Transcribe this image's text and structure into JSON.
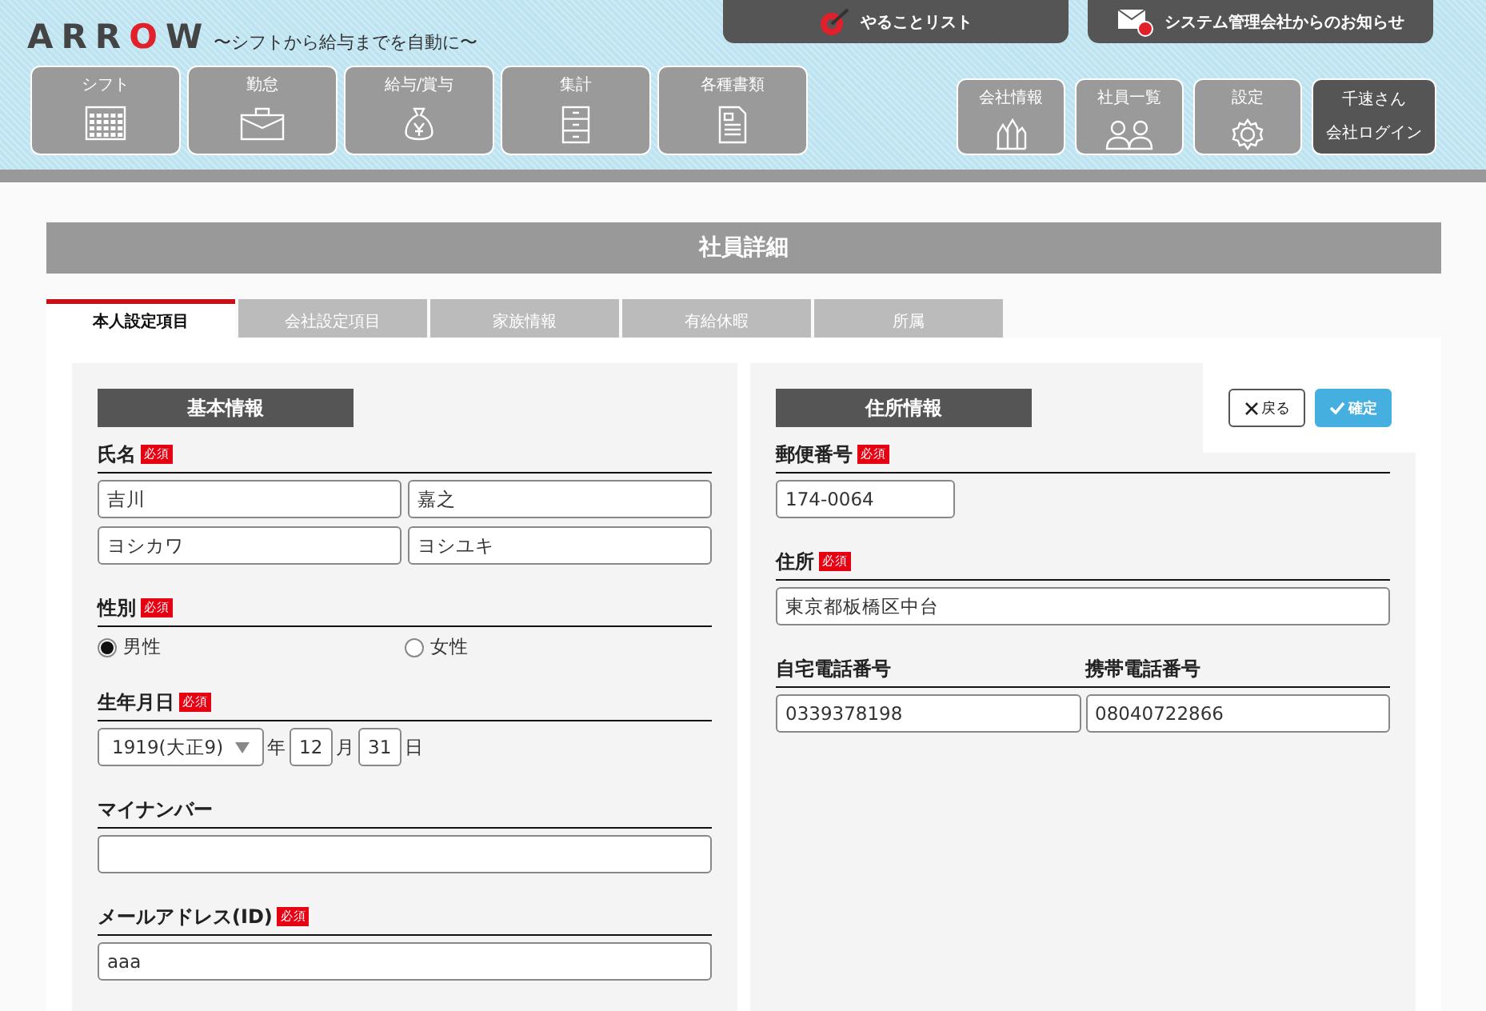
{
  "logo": {
    "text": "ARROW",
    "tagline": "〜シフトから給与までを自動に〜"
  },
  "top_links": [
    {
      "label": "やることリスト",
      "kind": "target"
    },
    {
      "label": "システム管理会社からのお知らせ",
      "kind": "mail"
    }
  ],
  "main_nav": [
    {
      "label": "シフト",
      "kind": "calendar"
    },
    {
      "label": "勤怠",
      "kind": "briefcase"
    },
    {
      "label": "給与/賞与",
      "kind": "moneybag"
    },
    {
      "label": "集計",
      "kind": "drawers"
    },
    {
      "label": "各種書類",
      "kind": "document"
    }
  ],
  "sub_nav": [
    {
      "label": "会社情報",
      "kind": "buildings"
    },
    {
      "label": "社員一覧",
      "kind": "people"
    },
    {
      "label": "設定",
      "kind": "gear"
    }
  ],
  "account": {
    "name": "千速さん",
    "action": "会社ログイン"
  },
  "page_title": "社員詳細",
  "tabs": [
    {
      "label": "本人設定項目",
      "selected": true
    },
    {
      "label": "会社設定項目",
      "selected": false
    },
    {
      "label": "家族情報",
      "selected": false
    },
    {
      "label": "有給休暇",
      "selected": false
    },
    {
      "label": "所属",
      "selected": false
    }
  ],
  "left_panel": {
    "section_title": "基本情報",
    "fields": [
      {
        "kind": "name",
        "label": "氏名",
        "badge": "必須",
        "values": [
          "吉川",
          "嘉之",
          "ヨシカワ",
          "ヨシユキ"
        ]
      },
      {
        "kind": "radio",
        "label": "性別",
        "badge": "必須",
        "options": [
          {
            "label": "男性",
            "selected": true
          },
          {
            "label": "女性",
            "selected": false
          }
        ]
      },
      {
        "kind": "date",
        "label": "生年月日",
        "badge": "必須",
        "year": "1919(大正9)",
        "year_unit": "年",
        "month": "12",
        "month_unit": "月",
        "day": "31",
        "day_unit": "日"
      },
      {
        "kind": "text",
        "label": "マイナンバー"
      },
      {
        "kind": "text",
        "label": "メールアドレス(ID)",
        "badge": "必須",
        "value": "aaa"
      }
    ]
  },
  "right_panel": {
    "section_title": "住所情報",
    "buttons": [
      {
        "label": "戻る",
        "kind": "back"
      },
      {
        "label": "確定",
        "kind": "confirm"
      }
    ],
    "fields": [
      {
        "kind": "short",
        "label": "郵便番号",
        "badge": "必須",
        "value": "174-0064"
      },
      {
        "kind": "text",
        "label": "住所",
        "badge": "必須",
        "value": "東京都板橋区中台"
      },
      {
        "kind": "pair",
        "columns": [
          {
            "label": "自宅電話番号",
            "value": "0339378198"
          },
          {
            "label": "携帯電話番号",
            "value": "08040722866"
          }
        ]
      }
    ]
  }
}
